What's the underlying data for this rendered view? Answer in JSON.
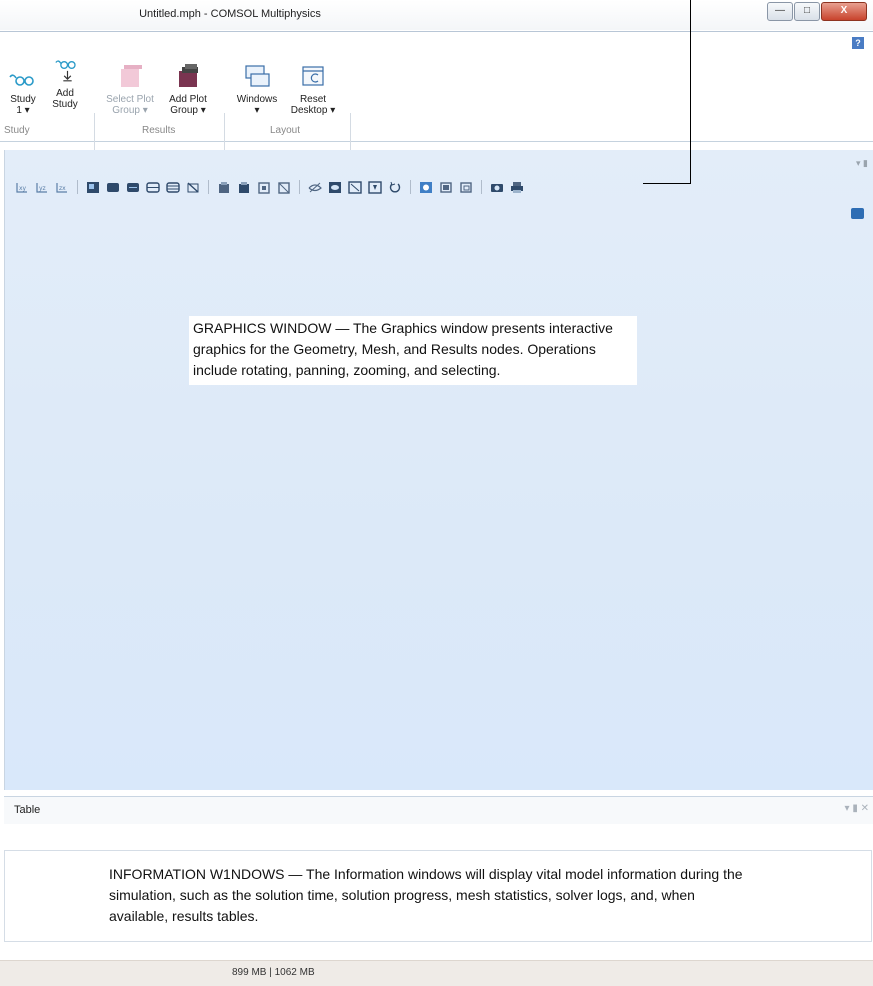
{
  "window": {
    "title": "Untitled.mph - COMSOL Multiphysics",
    "close_label": "X"
  },
  "help_label": "?",
  "ribbon": {
    "study1": {
      "line1": "Study",
      "line2": "1 ▾"
    },
    "add_study": {
      "line1": "Add",
      "line2": "Study"
    },
    "select_plot_group": {
      "line1": "Select Plot",
      "line2": "Group ▾"
    },
    "add_plot_group": {
      "line1": "Add Plot",
      "line2": "Group ▾"
    },
    "windows": {
      "line1": "Windows",
      "line2": "▾"
    },
    "reset_desktop": {
      "line1": "Reset",
      "line2": "Desktop ▾"
    },
    "groups": {
      "study": "Study",
      "results": "Results",
      "layout": "Layout"
    }
  },
  "graphics_toolbar": {
    "icons": [
      "xy-view-icon",
      "yz-view-icon",
      "zx-view-icon",
      "zoom-box-icon",
      "zoom-in-icon",
      "zoom-out-icon",
      "zoom-extents-icon",
      "zoom-selected-icon",
      "scene-light-icon",
      "select-object-icon",
      "select-domain-icon",
      "select-boundary-icon",
      "select-edge-icon",
      "hide-icon",
      "wireframe-icon",
      "transparency-icon",
      "render-icon",
      "reset-view-icon",
      "view-1-icon",
      "view-2-icon",
      "view-3-icon",
      "camera-icon",
      "print-icon"
    ]
  },
  "callouts": {
    "graphics": "GRAPHICS WINDOW — The Graphics window presents interactive graphics for the Geometry, Mesh, and Results nodes. Operations include rotating, panning, zooming, and selecting.",
    "information": "INFORMATION W1NDOWS — The Information windows will display vital model information during the simulation, such as the solution time, solution progress, mesh statistics, solver logs, and, when available, results tables."
  },
  "table_tab": {
    "label": "Table",
    "controls": "▾ ▮ ✕"
  },
  "panel_controls": "▾ ▮",
  "status": {
    "memory": "899 MB | 1062 MB"
  }
}
